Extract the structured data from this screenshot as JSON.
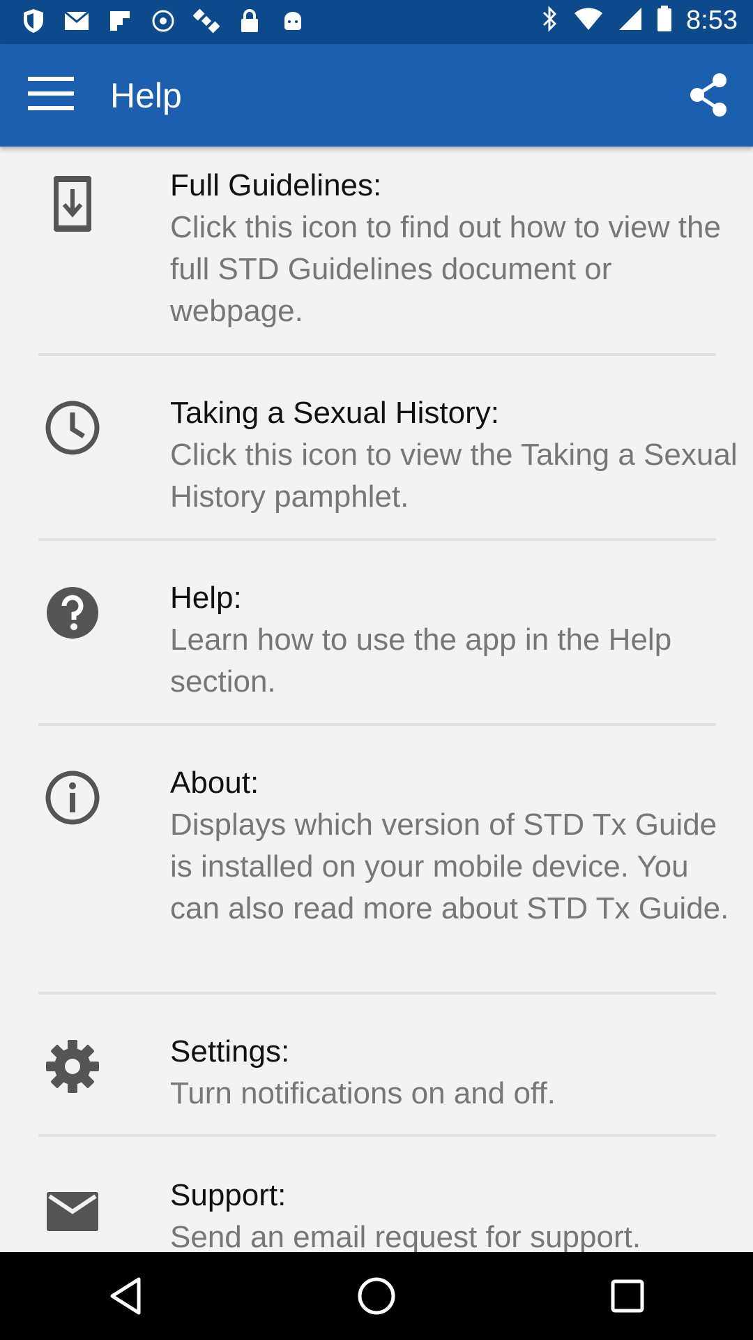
{
  "status_bar": {
    "time": "8:53",
    "icons": [
      "shield-icon",
      "gmail-icon",
      "flipboard-icon",
      "fake-gps-icon",
      "satellite-icon",
      "lock-icon",
      "android-icon",
      "bluetooth-icon",
      "wifi-icon",
      "signal-icon",
      "battery-icon"
    ]
  },
  "app_bar": {
    "title": "Help",
    "menu_icon": "menu-icon",
    "share_icon": "share-icon"
  },
  "items": [
    {
      "icon": "download-document-icon",
      "title": "Full Guidelines:",
      "description": "Click this icon to find out how to view the full STD Guidelines document or webpage."
    },
    {
      "icon": "clock-icon",
      "title": "Taking a Sexual History:",
      "description": "Click this icon to view the Taking a Sexual History pamphlet."
    },
    {
      "icon": "help-icon",
      "title": "Help:",
      "description": "Learn how to use the app in the Help section."
    },
    {
      "icon": "info-icon",
      "title": "About:",
      "description": "Displays which version of STD Tx Guide is installed on your mobile device. You can also read more about STD Tx Guide."
    },
    {
      "icon": "settings-icon",
      "title": "Settings:",
      "description": "Turn notifications on and off."
    },
    {
      "icon": "email-icon",
      "title": "Support:",
      "description": "Send an email request for support."
    }
  ],
  "nav_bar": {
    "back_icon": "back-icon",
    "home_icon": "home-icon",
    "recents_icon": "recents-icon"
  },
  "colors": {
    "status_bar": "#0d4a8c",
    "app_bar": "#1b5fae",
    "background": "#f3f3f3",
    "icon": "#555555"
  }
}
